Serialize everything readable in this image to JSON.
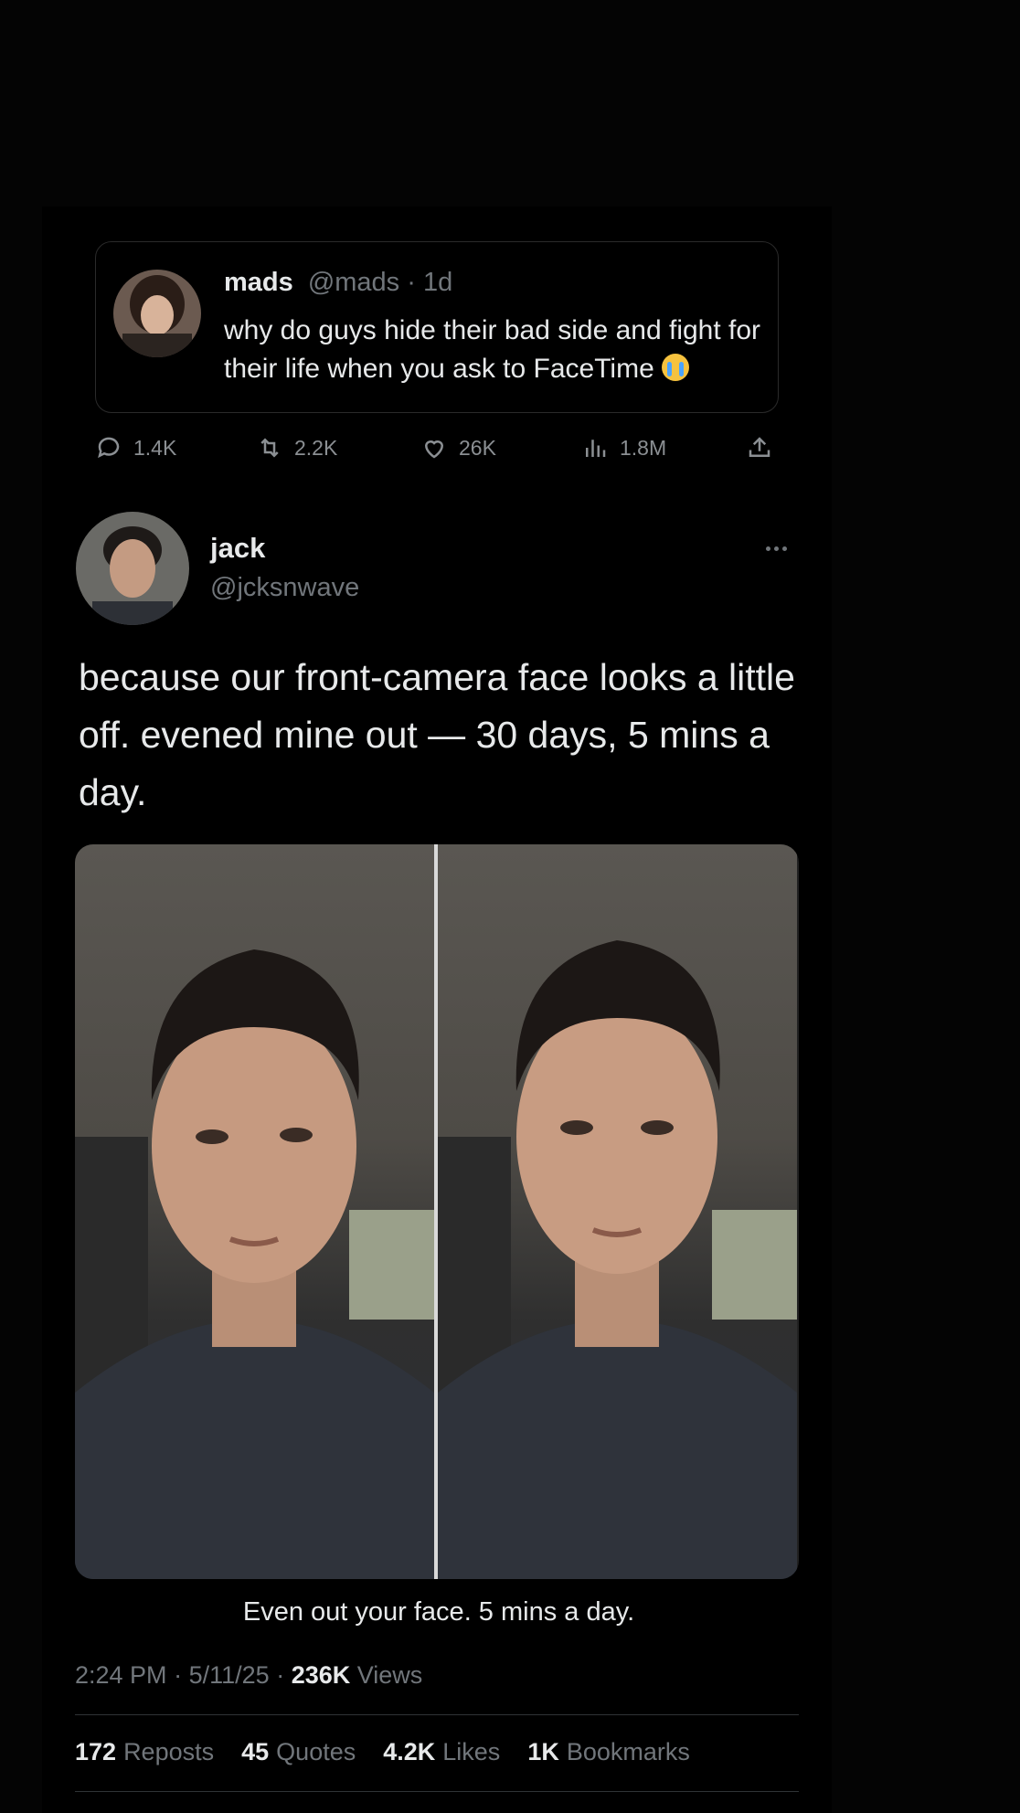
{
  "quoted": {
    "name": "mads",
    "meta": "@mads · 1d",
    "text": "why do guys hide their bad side and fight for their life when you ask to FaceTime",
    "emoji_icon": "loudly-crying-face-icon"
  },
  "actions": {
    "replies": "1.4K",
    "reposts": "2.2K",
    "likes": "26K",
    "views": "1.8M"
  },
  "author": {
    "name": "jack",
    "handle": "@jcksnwave"
  },
  "post": {
    "text": "because our front-camera face looks a little off. evened mine out — 30 days, 5 mins a day.",
    "caption": "Even out your face. 5 mins a day."
  },
  "meta": {
    "time": "2:24 PM",
    "date": "5/11/25",
    "views_count": "236K",
    "views_label": "Views"
  },
  "stats": {
    "reposts_count": "172",
    "reposts_label": "Reposts",
    "quotes_count": "45",
    "quotes_label": "Quotes",
    "likes_count": "4.2K",
    "likes_label": "Likes",
    "bookmarks_count": "1K",
    "bookmarks_label": "Bookmarks"
  },
  "colors": {
    "background": "#000000",
    "text": "#e7e9ea",
    "secondary": "#71767b"
  }
}
